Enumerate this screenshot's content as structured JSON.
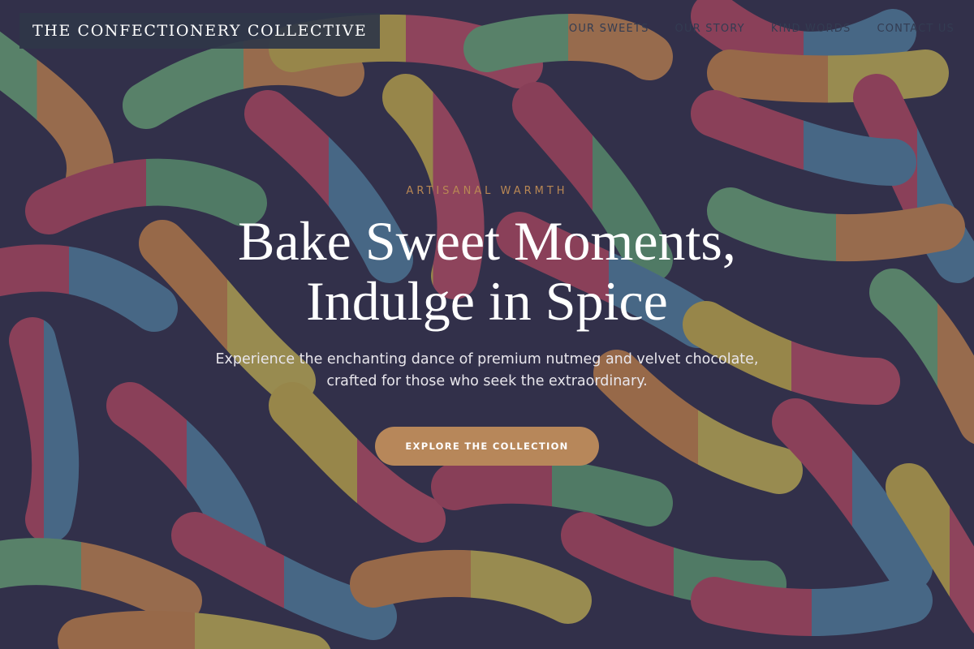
{
  "header": {
    "brand": "THE CONFECTIONERY COLLECTIVE",
    "nav": [
      {
        "label": "OUR SWEETS"
      },
      {
        "label": "OUR STORY"
      },
      {
        "label": "KIND WORDS"
      },
      {
        "label": "CONTACT US"
      }
    ]
  },
  "hero": {
    "eyebrow": "ARTISANAL WARMTH",
    "headline_line1": "Bake Sweet Moments,",
    "headline_line2": "Indulge in Spice",
    "subtitle": "Experience the enchanting dance of premium nutmeg and velvet chocolate, crafted for those who seek the extraordinary.",
    "cta_label": "EXPLORE THE COLLECTION",
    "background_image": "sour-gummy-worms-photo"
  },
  "colors": {
    "accent": "#b7875a",
    "eyebrow": "#b88754",
    "nav_text": "#333c52",
    "brand_bg": "#2f3748"
  }
}
